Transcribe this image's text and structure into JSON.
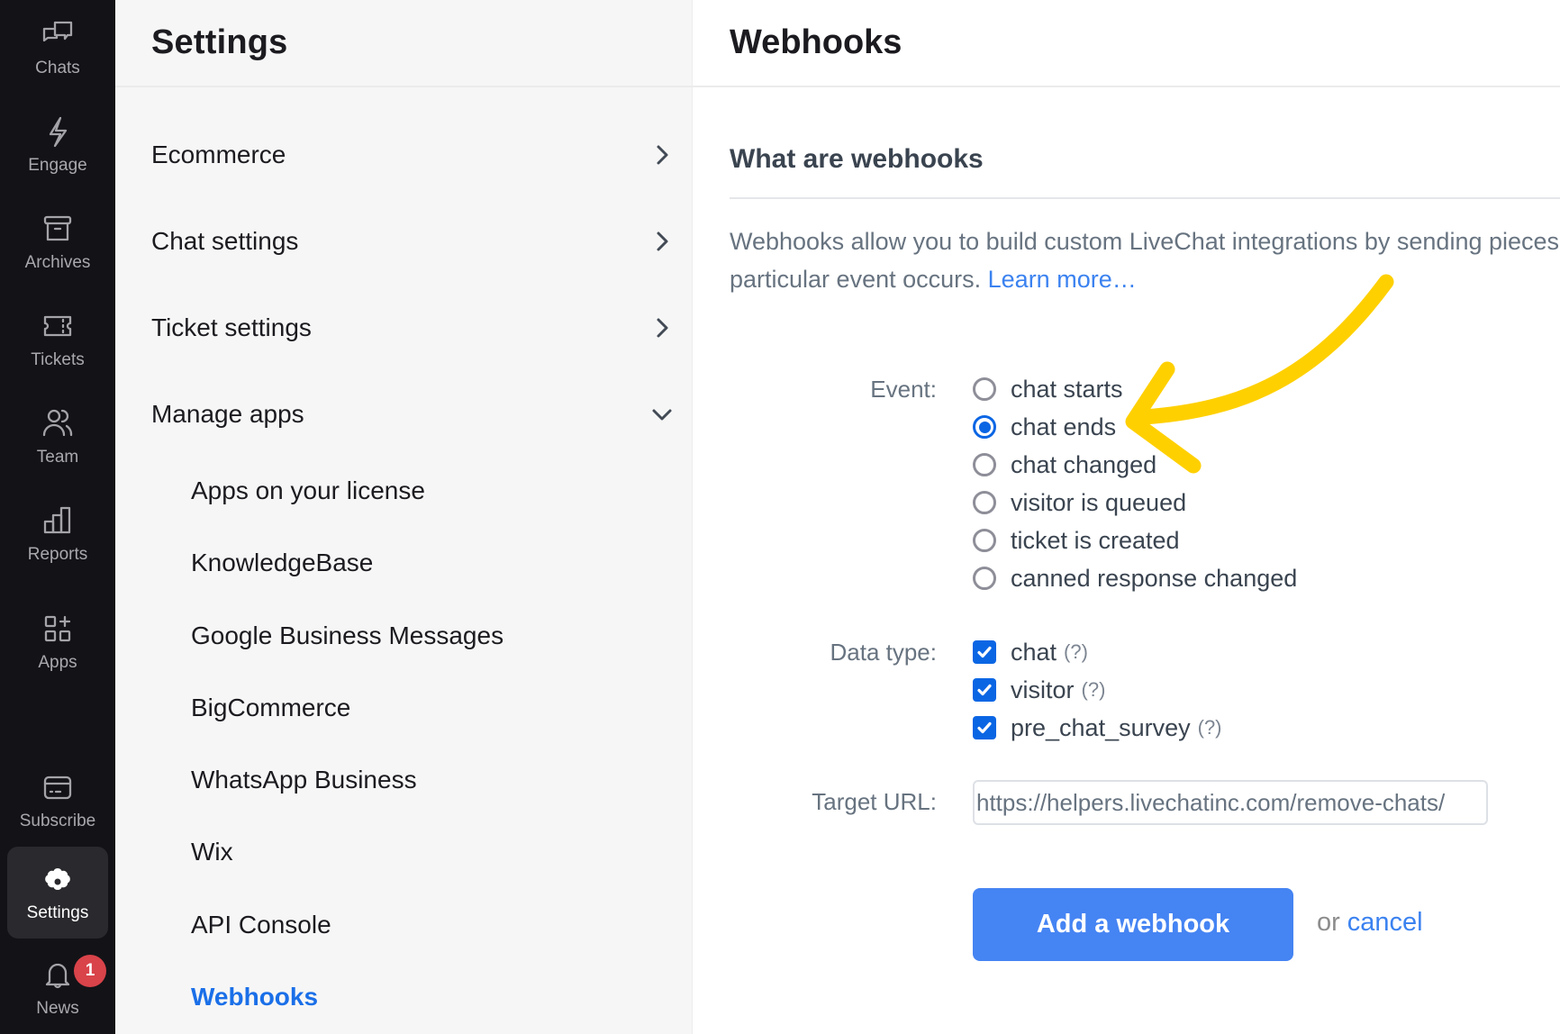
{
  "nav": {
    "items": [
      {
        "label": "Chats",
        "icon": "chat-bubbles-icon"
      },
      {
        "label": "Engage",
        "icon": "lightning-icon"
      },
      {
        "label": "Archives",
        "icon": "archive-box-icon"
      },
      {
        "label": "Tickets",
        "icon": "ticket-icon"
      },
      {
        "label": "Team",
        "icon": "team-icon"
      },
      {
        "label": "Reports",
        "icon": "bar-chart-icon"
      },
      {
        "label": "Apps",
        "icon": "apps-grid-icon"
      },
      {
        "label": "Subscribe",
        "icon": "credit-card-icon"
      },
      {
        "label": "Settings",
        "icon": "gear-icon",
        "active": true
      },
      {
        "label": "News",
        "icon": "bell-icon",
        "badge": "1"
      }
    ]
  },
  "settings_panel": {
    "title": "Settings",
    "menu": [
      {
        "label": "Ecommerce",
        "icon": "chevron-right-icon"
      },
      {
        "label": "Chat settings",
        "icon": "chevron-right-icon"
      },
      {
        "label": "Ticket settings",
        "icon": "chevron-right-icon"
      },
      {
        "label": "Manage apps",
        "icon": "chevron-down-icon",
        "expanded": true
      }
    ],
    "submenu": [
      {
        "label": "Apps on your license"
      },
      {
        "label": "KnowledgeBase"
      },
      {
        "label": "Google Business Messages"
      },
      {
        "label": "BigCommerce"
      },
      {
        "label": "WhatsApp Business"
      },
      {
        "label": "Wix"
      },
      {
        "label": "API Console"
      },
      {
        "label": "Webhooks",
        "active": true
      }
    ]
  },
  "main": {
    "title": "Webhooks",
    "section_title": "What are webhooks",
    "description_line1": "Webhooks allow you to build custom LiveChat integrations by sending pieces of",
    "description_line2": "particular event occurs.",
    "learn_more": "Learn more…",
    "form": {
      "event_label": "Event:",
      "events": [
        {
          "label": "chat starts",
          "selected": false
        },
        {
          "label": "chat ends",
          "selected": true
        },
        {
          "label": "chat changed",
          "selected": false
        },
        {
          "label": "visitor is queued",
          "selected": false
        },
        {
          "label": "ticket is created",
          "selected": false
        },
        {
          "label": "canned response changed",
          "selected": false
        }
      ],
      "data_type_label": "Data type:",
      "data_types": [
        {
          "label": "chat",
          "checked": true,
          "help": "(?)"
        },
        {
          "label": "visitor",
          "checked": true,
          "help": "(?)"
        },
        {
          "label": "pre_chat_survey",
          "checked": true,
          "help": "(?)"
        }
      ],
      "target_url_label": "Target URL:",
      "target_url_value": "https://helpers.livechatinc.com/remove-chats/",
      "submit_label": "Add a webhook",
      "or_text": "or",
      "cancel_label": "cancel"
    }
  },
  "colors": {
    "accent": "#0b66e4",
    "button": "#4584f3",
    "link": "#3b82f0",
    "badge": "#d9434a",
    "annotation_arrow": "#ffd000"
  }
}
